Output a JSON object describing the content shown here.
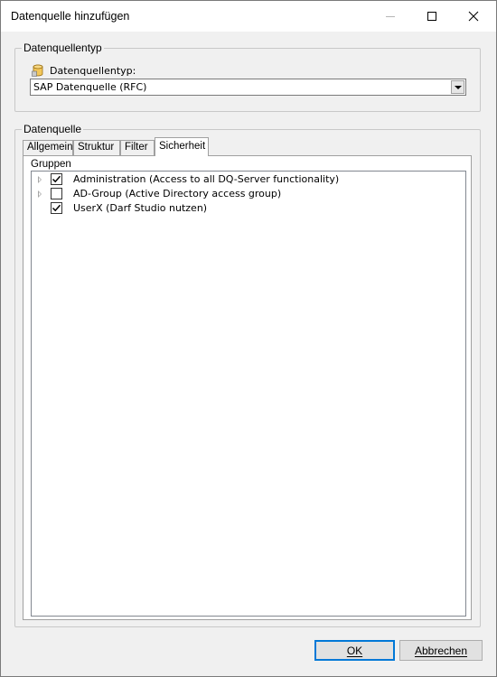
{
  "window": {
    "title": "Datenquelle hinzufügen"
  },
  "type_group": {
    "legend": "Datenquellentyp",
    "field_label": "Datenquellentyp:",
    "field_icon": "database-icon",
    "selected_value": "SAP Datenquelle (RFC)"
  },
  "source_group": {
    "legend": "Datenquelle",
    "tabs": [
      {
        "label": "Allgemein",
        "active": false
      },
      {
        "label": "Struktur",
        "active": false
      },
      {
        "label": "Filter",
        "active": false
      },
      {
        "label": "Sicherheit",
        "active": true
      }
    ],
    "groups_legend": "Gruppen",
    "groups": [
      {
        "label": "Administration (Access to all DQ-Server functionality)",
        "checked": true,
        "expandable": true
      },
      {
        "label": "AD-Group (Active Directory access group)",
        "checked": false,
        "expandable": true
      },
      {
        "label": "UserX (Darf Studio nutzen)",
        "checked": true,
        "expandable": false
      }
    ]
  },
  "buttons": {
    "ok_label": "OK",
    "cancel_label": "Abbrechen"
  },
  "colors": {
    "focus_border": "#0078d7",
    "dialog_bg": "#f0f0f0"
  }
}
